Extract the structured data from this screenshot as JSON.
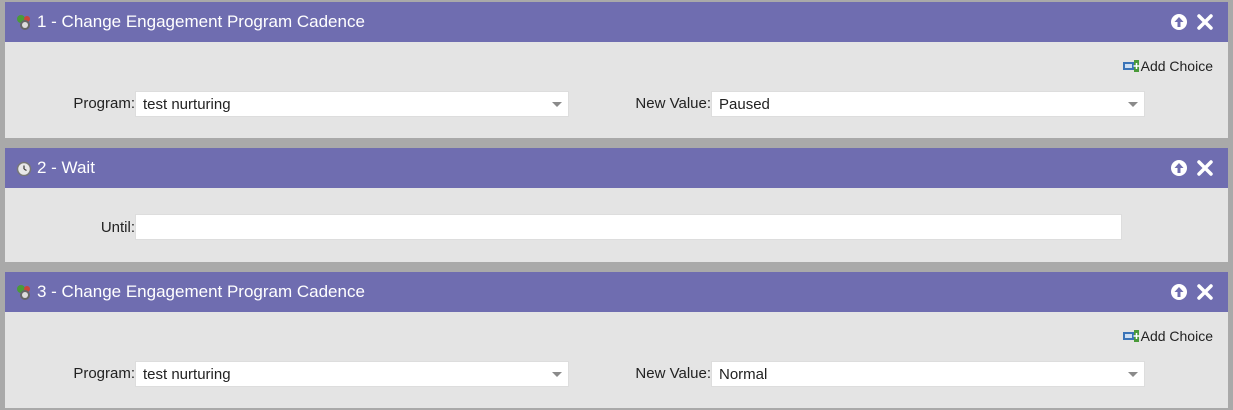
{
  "steps": [
    {
      "title": "1 - Change Engagement Program Cadence",
      "icon": "engagement-program-icon",
      "add_choice_label": "Add Choice",
      "program_label": "Program:",
      "program_value": "test nurturing",
      "new_value_label": "New Value:",
      "new_value": "Paused"
    },
    {
      "title": "2 - Wait",
      "icon": "clock-icon",
      "until_label": "Until:",
      "until_value": ""
    },
    {
      "title": "3 - Change Engagement Program Cadence",
      "icon": "engagement-program-icon",
      "add_choice_label": "Add Choice",
      "program_label": "Program:",
      "program_value": "test nurturing",
      "new_value_label": "New Value:",
      "new_value": "Normal"
    }
  ],
  "colors": {
    "header": "#6f6db0",
    "panel": "#e4e4e4",
    "background": "#a9a9a9"
  }
}
